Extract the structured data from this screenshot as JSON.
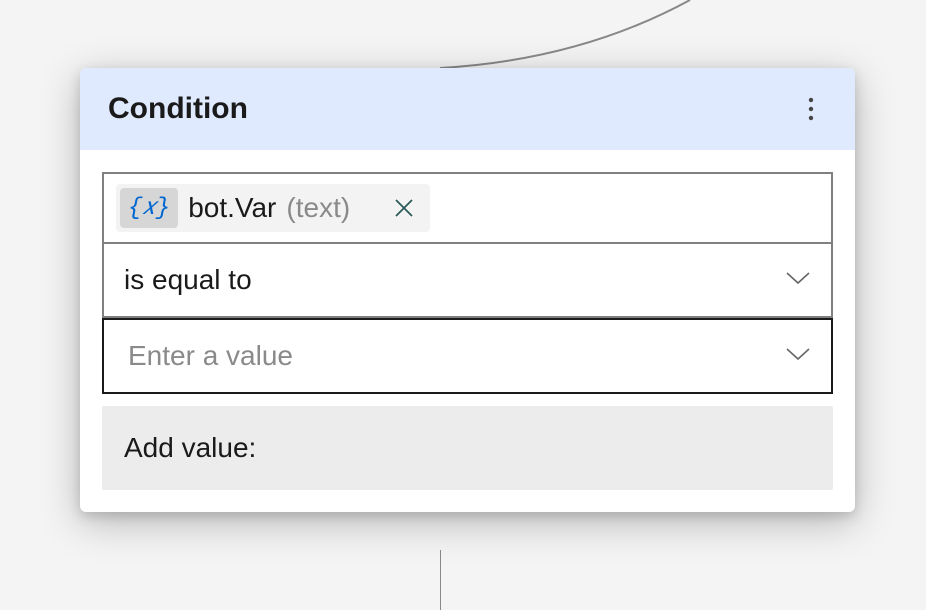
{
  "card": {
    "title": "Condition",
    "variable": {
      "icon_label": "{𝑥}",
      "name": "bot.Var",
      "type_label": "(text)"
    },
    "operator": {
      "selected": "is equal to"
    },
    "value_input": {
      "placeholder": "Enter a value"
    },
    "dropdown": {
      "header": "Add value:"
    }
  },
  "colors": {
    "header_bg": "#e0eaff",
    "accent": "#0066d1",
    "chip_bg": "#f3f3f3",
    "icon_bg": "#d6d6d6",
    "panel_bg": "#ececec"
  }
}
